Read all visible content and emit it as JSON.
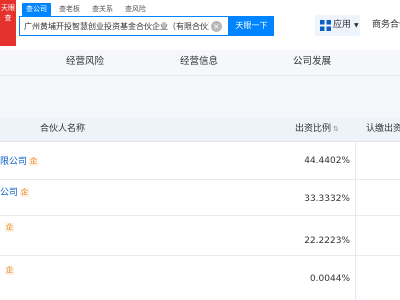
{
  "logo": {
    "text": "天眼查"
  },
  "search": {
    "tabs": [
      "查公司",
      "查老板",
      "查关系",
      "查风险"
    ],
    "query": "广州黄埔开投智慧创业投资基金合伙企业（有限合伙）",
    "button_label": "天眼一下"
  },
  "header": {
    "app_label": "应用",
    "cooperate_label": "商务合作"
  },
  "nav": {
    "items": [
      "经营风险",
      "经营信息",
      "公司发展"
    ]
  },
  "table": {
    "columns": [
      "合伙人名称",
      "出资比例",
      "认缴出资"
    ],
    "rows": [
      {
        "name": "限公司",
        "tag": "企",
        "ratio": "44.4402%"
      },
      {
        "name": "公司",
        "tag": "企",
        "ratio": "33.3332%"
      },
      {
        "name": "",
        "tag": "企",
        "ratio": "22.2223%"
      },
      {
        "name": "",
        "tag": "企",
        "ratio": "0.0044%"
      }
    ]
  },
  "colors": {
    "accent": "#0084ff",
    "link": "#0a5ec7",
    "tag": "#d97a1a"
  }
}
